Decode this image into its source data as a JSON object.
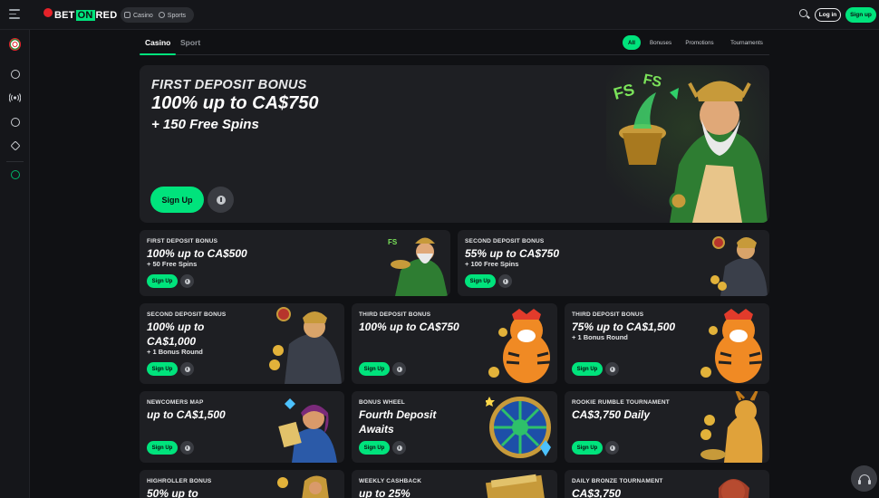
{
  "header": {
    "logo": {
      "pre": "BET",
      "on": "ON",
      "post": "RED"
    },
    "switch": {
      "casino": "Casino",
      "sports": "Sports"
    },
    "login_label": "Log in",
    "signup_label": "Sign up"
  },
  "sidebar": {
    "items": [
      "wheel-icon",
      "casino-chip-icon",
      "live-icon",
      "soccer-ball-icon",
      "horse-icon",
      "promotions-icon"
    ]
  },
  "tabs": {
    "casino": "Casino",
    "sport": "Sport"
  },
  "filters": {
    "all": "All",
    "bonuses": "Bonuses",
    "promotions": "Promotions",
    "tournaments": "Tournaments"
  },
  "hero": {
    "kicker": "FIRST DEPOSIT BONUS",
    "title": "100% up to CA$750",
    "subtitle": "+ 150 Free Spins",
    "signup_label": "Sign Up"
  },
  "cards": [
    {
      "kicker": "FIRST DEPOSIT BONUS",
      "title": "100% up to CA$500",
      "sub": "+ 50 Free Spins",
      "btn": "Sign Up"
    },
    {
      "kicker": "SECOND DEPOSIT BONUS",
      "title": "55% up to CA$750",
      "sub": "+ 100 Free Spins",
      "btn": "Sign Up"
    },
    {
      "kicker": "SECOND DEPOSIT BONUS",
      "title1": "100% up to",
      "title2": "CA$1,000",
      "sub": "+ 1 Bonus Round",
      "btn": "Sign Up"
    },
    {
      "kicker": "THIRD DEPOSIT BONUS",
      "title": "100% up to CA$750",
      "btn": "Sign Up"
    },
    {
      "kicker": "THIRD DEPOSIT BONUS",
      "title": "75% up to CA$1,500",
      "sub": "+ 1 Bonus Round",
      "btn": "Sign Up"
    },
    {
      "kicker": "NEWCOMERS MAP",
      "title": "up to CA$1,500",
      "btn": "Sign Up"
    },
    {
      "kicker": "BONUS WHEEL",
      "title1": "Fourth Deposit",
      "title2": "Awaits",
      "btn": "Sign Up"
    },
    {
      "kicker": "ROOKIE RUMBLE TOURNAMENT",
      "title": "CA$3,750 Daily",
      "btn": "Sign Up"
    },
    {
      "kicker": "HIGHROLLER BONUS",
      "title": "50% up to"
    },
    {
      "kicker": "WEEKLY CASHBACK",
      "title": "up to 25%"
    },
    {
      "kicker": "DAILY BRONZE TOURNAMENT",
      "title": "CA$3,750"
    }
  ],
  "colors": {
    "accent": "#00e37c",
    "brand_red": "#e52229",
    "bg": "#101114",
    "card": "#1e1f23"
  }
}
